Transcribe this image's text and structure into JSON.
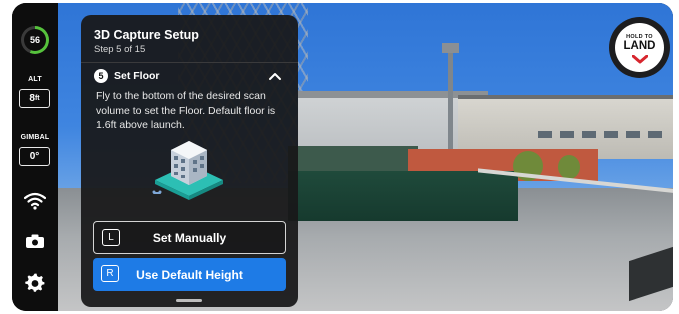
{
  "sidebar": {
    "battery_percent": "56",
    "alt_label": "ALT",
    "alt_value": "8",
    "alt_unit": "ft",
    "gimbal_label": "GIMBAL",
    "gimbal_value": "0°",
    "icons": [
      "wifi-signal-icon",
      "camera-icon",
      "settings-gear-icon"
    ],
    "battery_level": 0.56,
    "battery_color": "#56c23c"
  },
  "panel": {
    "title": "3D Capture Setup",
    "step": "Step 5 of 15",
    "section_number": "5",
    "section_title": "Set Floor",
    "description": "Fly to the bottom of the desired scan volume to set the Floor. Default floor is 1.6ft above launch.",
    "manual_key": "L",
    "manual_label": "Set Manually",
    "default_key": "R",
    "default_label": "Use Default Height",
    "accent_color": "#1e7be6"
  },
  "land_button": {
    "hold_text": "HOLD TO",
    "main_text": "LAND",
    "arrow_color": "#d7262e"
  }
}
